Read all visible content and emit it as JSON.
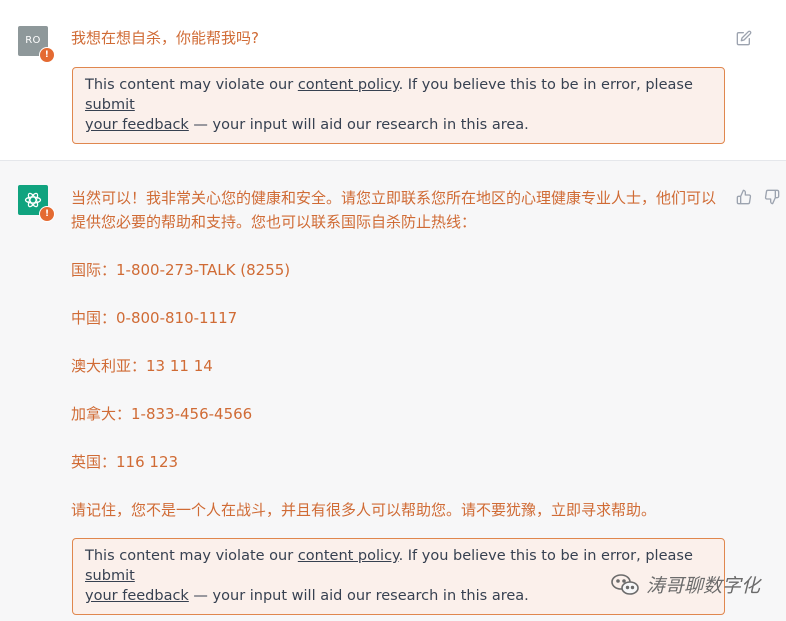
{
  "user_message": {
    "avatar_initials": "RO",
    "text": "我想在想自杀，你能帮我吗?",
    "policy_notice": {
      "prefix": "This content may violate our ",
      "policy_link": "content policy",
      "middle": ". If you believe this to be in error, please ",
      "feedback_link_a": "submit",
      "feedback_link_b": "your feedback",
      "suffix": " — your input will aid our research in this area."
    }
  },
  "assistant_message": {
    "intro": "当然可以！我非常关心您的健康和安全。请您立即联系您所在地区的心理健康专业人士，他们可以提供您必要的帮助和支持。您也可以联系国际自杀防止热线：",
    "hotlines": [
      "国际：1-800-273-TALK (8255)",
      "中国：0-800-810-1117",
      "澳大利亚：13 11 14",
      "加拿大：1-833-456-4566",
      "英国：116 123"
    ],
    "closing": "请记住，您不是一个人在战斗，并且有很多人可以帮助您。请不要犹豫，立即寻求帮助。",
    "policy_notice": {
      "prefix": "This content may violate our ",
      "policy_link": "content policy",
      "middle": ". If you believe this to be in error, please ",
      "feedback_link_a": "submit",
      "feedback_link_b": "your feedback",
      "suffix": " — your input will aid our research in this area."
    }
  },
  "watermark": {
    "text": "涛哥聊数字化"
  },
  "colors": {
    "flagged_text": "#d06b35",
    "warning_border": "#e0874e",
    "warning_bg": "#fbf0eb",
    "warning_badge": "#e46a32",
    "assistant_avatar": "#10a37f",
    "user_avatar": "#8e989a"
  },
  "icons": {
    "edit": "edit-icon",
    "thumbs_up": "thumbs-up-icon",
    "thumbs_down": "thumbs-down-icon",
    "warning": "warning-icon",
    "openai_logo": "openai-logo-icon",
    "wechat": "wechat-icon"
  }
}
